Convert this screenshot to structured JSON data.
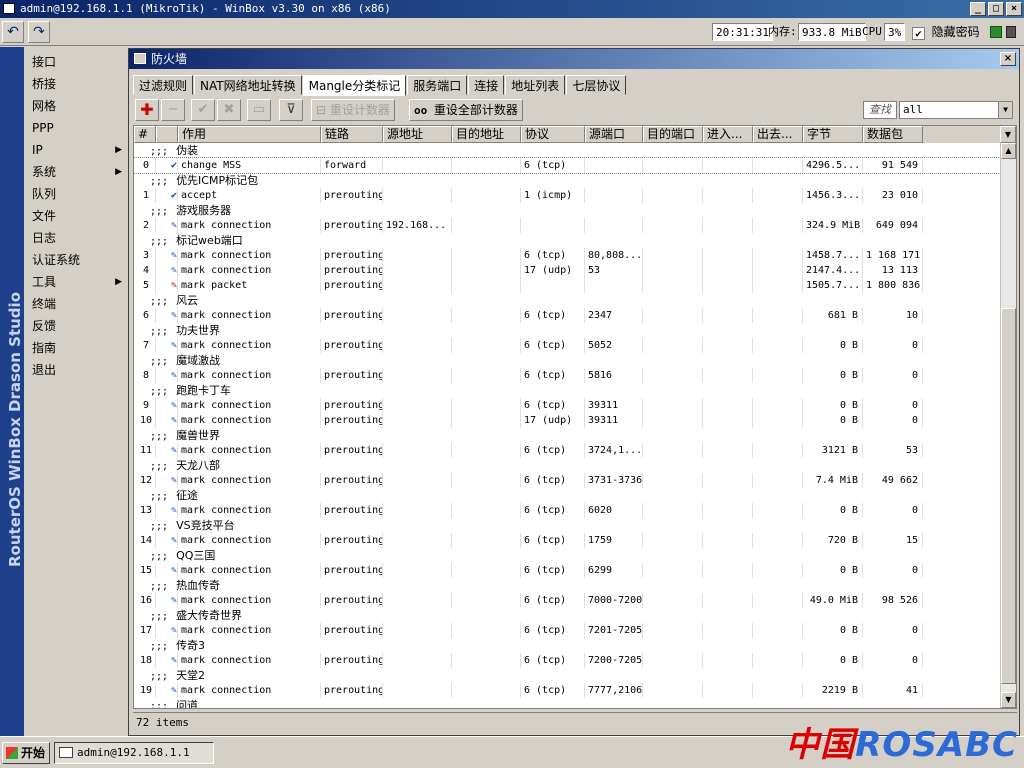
{
  "window": {
    "title": "admin@192.168.1.1 (MikroTik) - WinBox v3.30 on x86 (x86)"
  },
  "toolbar": {
    "time": "20:31:31",
    "memory_label": "内存:",
    "memory_value": "933.8 MiB",
    "cpu_label": "CPU:",
    "cpu_value": "3%",
    "hide_passwords_label": "隐藏密码",
    "hide_passwords_checked": "✔"
  },
  "sidebar": {
    "brand": "RouterOS WinBox    Drason Studio",
    "items": [
      {
        "label": "接口",
        "sub": false
      },
      {
        "label": "桥接",
        "sub": false
      },
      {
        "label": "网格",
        "sub": false
      },
      {
        "label": "PPP",
        "sub": false
      },
      {
        "label": "IP",
        "sub": true
      },
      {
        "label": "系统",
        "sub": true
      },
      {
        "label": "队列",
        "sub": false
      },
      {
        "label": "文件",
        "sub": false
      },
      {
        "label": "日志",
        "sub": false
      },
      {
        "label": "认证系统",
        "sub": false
      },
      {
        "label": "工具",
        "sub": true
      },
      {
        "label": "终端",
        "sub": false
      },
      {
        "label": "反馈",
        "sub": false
      },
      {
        "label": "指南",
        "sub": false
      },
      {
        "label": "退出",
        "sub": false
      }
    ]
  },
  "firewall": {
    "title": "防火墙",
    "tabs": [
      "过滤规则",
      "NAT网络地址转换",
      "Mangle分类标记",
      "服务端口",
      "连接",
      "地址列表",
      "七层协议"
    ],
    "active_tab": 2,
    "reset_counters_label": "重设计数器",
    "reset_all_counters_label": "重设全部计数器",
    "search_label": "查找",
    "filter_value": "all",
    "columns": [
      "#",
      "作用",
      "链路",
      "源地址",
      "目的地址",
      "协议",
      "源端口",
      "目的端口",
      "进入...",
      "出去...",
      "字节",
      "数据包"
    ],
    "rows": [
      {
        "type": "comment",
        "text": "伪装"
      },
      {
        "type": "rule",
        "idx": "0",
        "icon": "check",
        "action": "change MSS",
        "chain": "forward",
        "src": "",
        "dst": "",
        "proto": "6 (tcp)",
        "sport": "",
        "dport": "",
        "in": "",
        "out": "",
        "bytes": "4296.5...",
        "packets": "91 549",
        "selected": true
      },
      {
        "type": "comment",
        "text": "优先ICMP标记包"
      },
      {
        "type": "rule",
        "idx": "1",
        "icon": "check",
        "action": "accept",
        "chain": "prerouting",
        "src": "",
        "dst": "",
        "proto": "1 (icmp)",
        "sport": "",
        "dport": "",
        "in": "",
        "out": "",
        "bytes": "1456.3...",
        "packets": "23 010"
      },
      {
        "type": "comment",
        "text": "游戏服务器"
      },
      {
        "type": "rule",
        "idx": "2",
        "icon": "pen",
        "action": "mark connection",
        "chain": "prerouting",
        "src": "192.168...",
        "dst": "",
        "proto": "",
        "sport": "",
        "dport": "",
        "in": "",
        "out": "",
        "bytes": "324.9 MiB",
        "packets": "649 094"
      },
      {
        "type": "comment",
        "text": "标记web端口"
      },
      {
        "type": "rule",
        "idx": "3",
        "icon": "pen",
        "action": "mark connection",
        "chain": "prerouting",
        "src": "",
        "dst": "",
        "proto": "6 (tcp)",
        "sport": "80,808...",
        "dport": "",
        "in": "",
        "out": "",
        "bytes": "1458.7...",
        "packets": "1 168 171"
      },
      {
        "type": "rule",
        "idx": "4",
        "icon": "pen",
        "action": "mark connection",
        "chain": "prerouting",
        "src": "",
        "dst": "",
        "proto": "17 (udp)",
        "sport": "53",
        "dport": "",
        "in": "",
        "out": "",
        "bytes": "2147.4...",
        "packets": "13 113"
      },
      {
        "type": "rule",
        "idx": "5",
        "icon": "redpen",
        "action": "mark packet",
        "chain": "prerouting",
        "src": "",
        "dst": "",
        "proto": "",
        "sport": "",
        "dport": "",
        "in": "",
        "out": "",
        "bytes": "1505.7...",
        "packets": "1 800 836"
      },
      {
        "type": "comment",
        "text": "风云"
      },
      {
        "type": "rule",
        "idx": "6",
        "icon": "pen",
        "action": "mark connection",
        "chain": "prerouting",
        "src": "",
        "dst": "",
        "proto": "6 (tcp)",
        "sport": "2347",
        "dport": "",
        "in": "",
        "out": "",
        "bytes": "681 B",
        "packets": "10"
      },
      {
        "type": "comment",
        "text": "功夫世界"
      },
      {
        "type": "rule",
        "idx": "7",
        "icon": "pen",
        "action": "mark connection",
        "chain": "prerouting",
        "src": "",
        "dst": "",
        "proto": "6 (tcp)",
        "sport": "5052",
        "dport": "",
        "in": "",
        "out": "",
        "bytes": "0 B",
        "packets": "0"
      },
      {
        "type": "comment",
        "text": "魔域激战"
      },
      {
        "type": "rule",
        "idx": "8",
        "icon": "pen",
        "action": "mark connection",
        "chain": "prerouting",
        "src": "",
        "dst": "",
        "proto": "6 (tcp)",
        "sport": "5816",
        "dport": "",
        "in": "",
        "out": "",
        "bytes": "0 B",
        "packets": "0"
      },
      {
        "type": "comment",
        "text": "跑跑卡丁车"
      },
      {
        "type": "rule",
        "idx": "9",
        "icon": "pen",
        "action": "mark connection",
        "chain": "prerouting",
        "src": "",
        "dst": "",
        "proto": "6 (tcp)",
        "sport": "39311",
        "dport": "",
        "in": "",
        "out": "",
        "bytes": "0 B",
        "packets": "0"
      },
      {
        "type": "rule",
        "idx": "10",
        "icon": "pen",
        "action": "mark connection",
        "chain": "prerouting",
        "src": "",
        "dst": "",
        "proto": "17 (udp)",
        "sport": "39311",
        "dport": "",
        "in": "",
        "out": "",
        "bytes": "0 B",
        "packets": "0"
      },
      {
        "type": "comment",
        "text": "魔兽世界"
      },
      {
        "type": "rule",
        "idx": "11",
        "icon": "pen",
        "action": "mark connection",
        "chain": "prerouting",
        "src": "",
        "dst": "",
        "proto": "6 (tcp)",
        "sport": "3724,1...",
        "dport": "",
        "in": "",
        "out": "",
        "bytes": "3121 B",
        "packets": "53"
      },
      {
        "type": "comment",
        "text": "天龙八部"
      },
      {
        "type": "rule",
        "idx": "12",
        "icon": "pen",
        "action": "mark connection",
        "chain": "prerouting",
        "src": "",
        "dst": "",
        "proto": "6 (tcp)",
        "sport": "3731-3736",
        "dport": "",
        "in": "",
        "out": "",
        "bytes": "7.4 MiB",
        "packets": "49 662"
      },
      {
        "type": "comment",
        "text": "征途"
      },
      {
        "type": "rule",
        "idx": "13",
        "icon": "pen",
        "action": "mark connection",
        "chain": "prerouting",
        "src": "",
        "dst": "",
        "proto": "6 (tcp)",
        "sport": "6020",
        "dport": "",
        "in": "",
        "out": "",
        "bytes": "0 B",
        "packets": "0"
      },
      {
        "type": "comment",
        "text": "VS竞技平台"
      },
      {
        "type": "rule",
        "idx": "14",
        "icon": "pen",
        "action": "mark connection",
        "chain": "prerouting",
        "src": "",
        "dst": "",
        "proto": "6 (tcp)",
        "sport": "1759",
        "dport": "",
        "in": "",
        "out": "",
        "bytes": "720 B",
        "packets": "15"
      },
      {
        "type": "comment",
        "text": "QQ三国"
      },
      {
        "type": "rule",
        "idx": "15",
        "icon": "pen",
        "action": "mark connection",
        "chain": "prerouting",
        "src": "",
        "dst": "",
        "proto": "6 (tcp)",
        "sport": "6299",
        "dport": "",
        "in": "",
        "out": "",
        "bytes": "0 B",
        "packets": "0"
      },
      {
        "type": "comment",
        "text": "热血传奇"
      },
      {
        "type": "rule",
        "idx": "16",
        "icon": "pen",
        "action": "mark connection",
        "chain": "prerouting",
        "src": "",
        "dst": "",
        "proto": "6 (tcp)",
        "sport": "7000-7200",
        "dport": "",
        "in": "",
        "out": "",
        "bytes": "49.0 MiB",
        "packets": "98 526"
      },
      {
        "type": "comment",
        "text": "盛大传奇世界"
      },
      {
        "type": "rule",
        "idx": "17",
        "icon": "pen",
        "action": "mark connection",
        "chain": "prerouting",
        "src": "",
        "dst": "",
        "proto": "6 (tcp)",
        "sport": "7201-7205",
        "dport": "",
        "in": "",
        "out": "",
        "bytes": "0 B",
        "packets": "0"
      },
      {
        "type": "comment",
        "text": "传奇3"
      },
      {
        "type": "rule",
        "idx": "18",
        "icon": "pen",
        "action": "mark connection",
        "chain": "prerouting",
        "src": "",
        "dst": "",
        "proto": "6 (tcp)",
        "sport": "7200-7205",
        "dport": "",
        "in": "",
        "out": "",
        "bytes": "0 B",
        "packets": "0"
      },
      {
        "type": "comment",
        "text": "天堂2"
      },
      {
        "type": "rule",
        "idx": "19",
        "icon": "pen",
        "action": "mark connection",
        "chain": "prerouting",
        "src": "",
        "dst": "",
        "proto": "6 (tcp)",
        "sport": "7777,2106",
        "dport": "",
        "in": "",
        "out": "",
        "bytes": "2219 B",
        "packets": "41"
      },
      {
        "type": "comment",
        "text": "问道"
      }
    ],
    "comment_prefix": ";;;",
    "status": "72 items"
  },
  "taskbar": {
    "start_label": "开始",
    "task_label": "admin@192.168.1.1 (..."
  },
  "watermark": {
    "part1": "中国",
    "part2": "ROSABC"
  }
}
